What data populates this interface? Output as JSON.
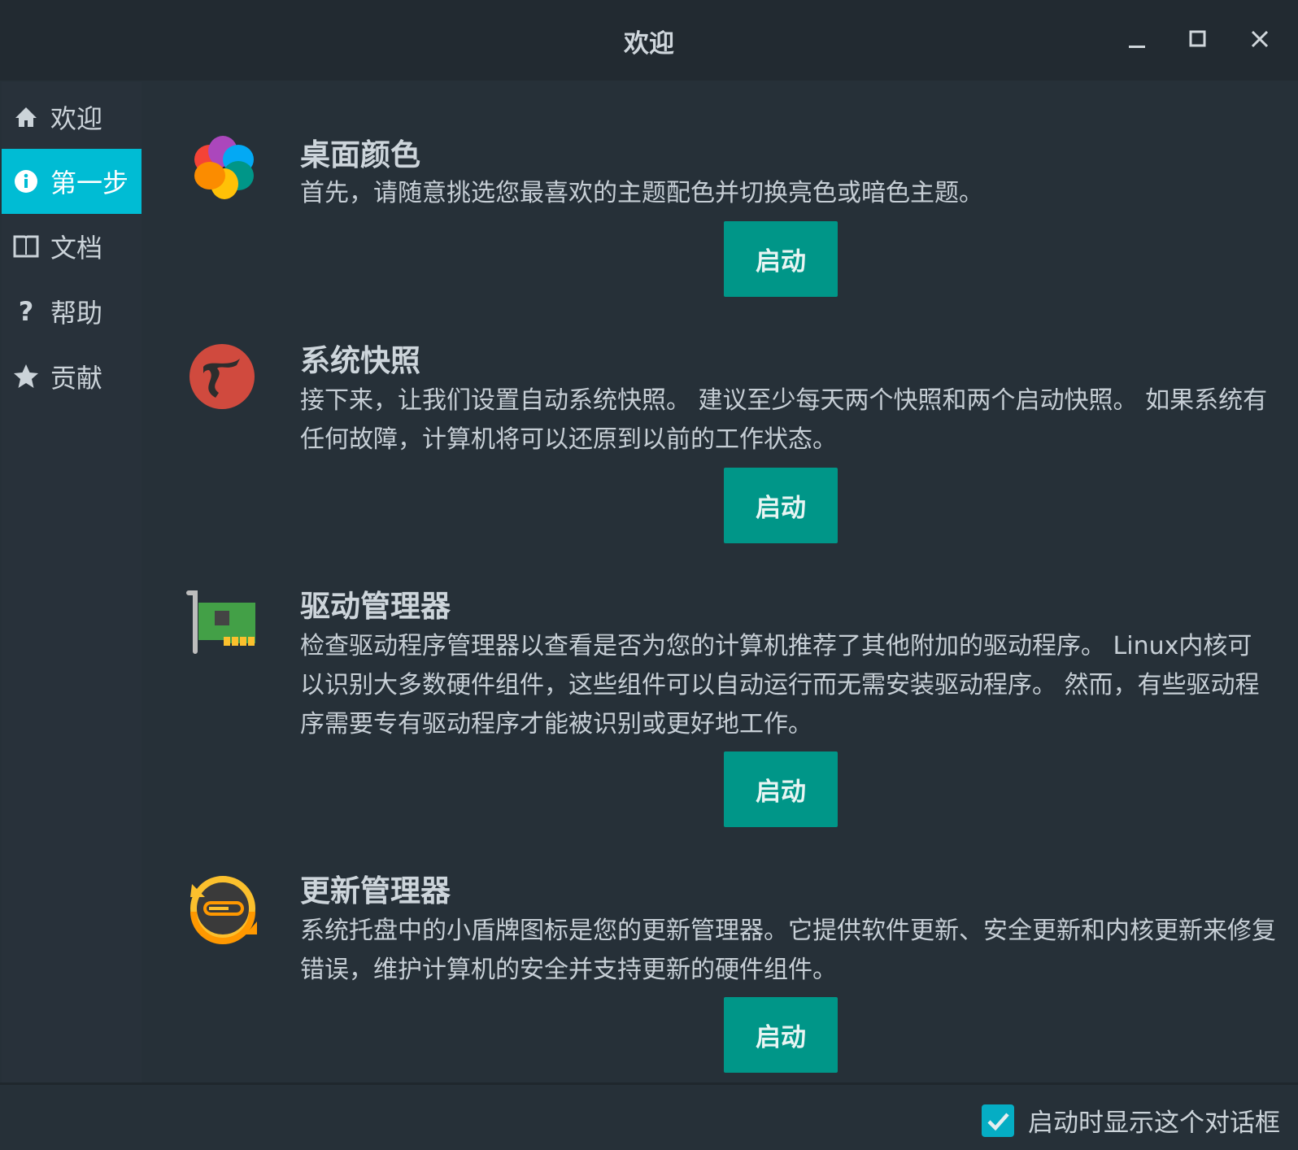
{
  "window": {
    "title": "欢迎"
  },
  "sidebar": {
    "items": [
      {
        "label": "欢迎",
        "icon": "home-icon"
      },
      {
        "label": "第一步",
        "icon": "info-icon",
        "active": true
      },
      {
        "label": "文档",
        "icon": "book-icon"
      },
      {
        "label": "帮助",
        "icon": "question-icon"
      },
      {
        "label": "贡献",
        "icon": "star-icon"
      }
    ]
  },
  "sections": [
    {
      "title": "桌面颜色",
      "description": "首先，请随意挑选您最喜欢的主题配色并切换亮色或暗色主题。",
      "button": "启动",
      "icon": "color-palette-icon"
    },
    {
      "title": "系统快照",
      "description": "接下来，让我们设置自动系统快照。 建议至少每天两个快照和两个启动快照。 如果系统有任何故障，计算机将可以还原到以前的工作状态。",
      "button": "启动",
      "icon": "timeshift-icon"
    },
    {
      "title": "驱动管理器",
      "description": "检查驱动程序管理器以查看是否为您的计算机推荐了其他附加的驱动程序。 Linux内核可以识别大多数硬件组件，这些组件可以自动运行而无需安装驱动程序。 然而，有些驱动程序需要专有驱动程序才能被识别或更好地工作。",
      "button": "启动",
      "icon": "driver-card-icon"
    },
    {
      "title": "更新管理器",
      "description": "系统托盘中的小盾牌图标是您的更新管理器。它提供软件更新、安全更新和内核更新来修复错误，维护计算机的安全并支持更新的硬件组件。",
      "button": "启动",
      "icon": "update-manager-icon"
    }
  ],
  "footer": {
    "show_on_startup_label": "启动时显示这个对话框",
    "show_on_startup_checked": true
  },
  "colors": {
    "accent": "#00bcd4",
    "button": "#009688"
  }
}
